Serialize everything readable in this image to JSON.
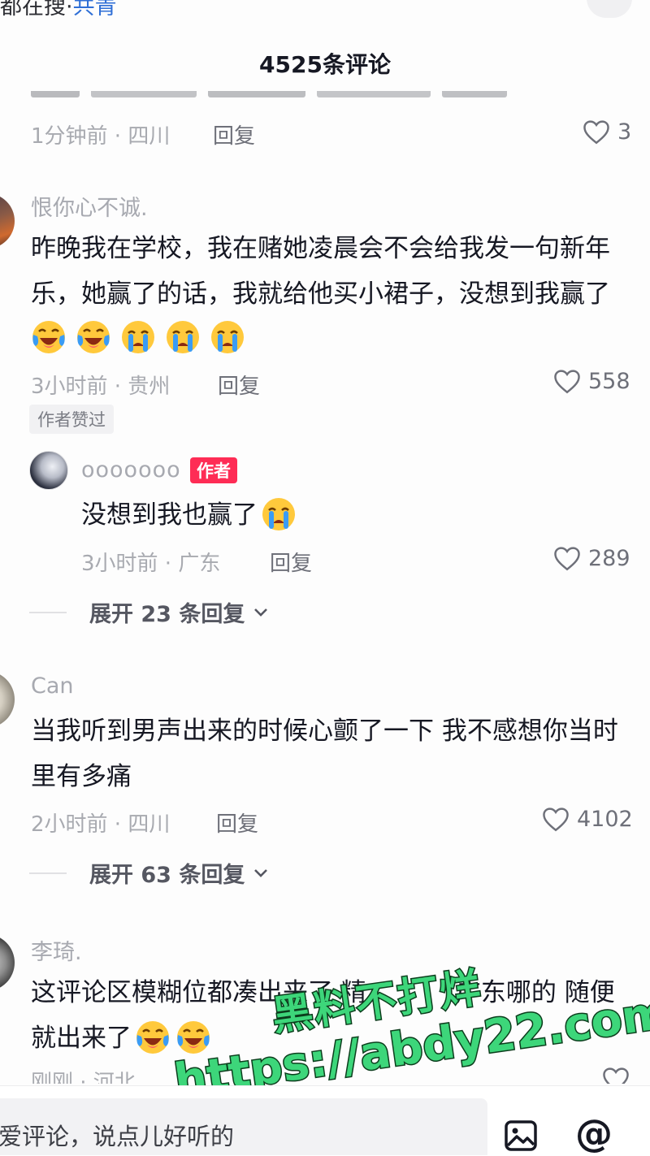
{
  "top": {
    "cut_text_left": "都在搜·",
    "cut_link": "共青",
    "title": "4525条评论"
  },
  "partial_comment": {
    "meta": "1分钟前 · 四川",
    "reply": "回复",
    "likes": "3"
  },
  "comments": [
    {
      "username": "恨你心不诚.",
      "line1": "昨晚我在学校，我在赌她凌晨会不会给我发一句新年",
      "line2": "乐，她赢了的话，我就给他买小裙子，没想到我赢了",
      "emojis": [
        "laugh-cry",
        "laugh-cry",
        "crying",
        "crying",
        "crying"
      ],
      "meta": "3小时前 · 贵州",
      "reply": "回复",
      "likes": "558",
      "badge": "作者赞过",
      "sub": {
        "username": "ooooooo",
        "tag": "作者",
        "text": "没想到我也赢了",
        "meta": "3小时前 · 广东",
        "reply": "回复",
        "likes": "289"
      },
      "expand": "展开 23 条回复"
    },
    {
      "username": "Can",
      "line1": "当我听到男声出来的时候心颤了一下 我不感想你当时",
      "line2": "里有多痛",
      "meta": "2小时前 · 四川",
      "reply": "回复",
      "likes": "4102",
      "expand": "展开 63 条回复"
    },
    {
      "username": "李琦.",
      "line1": "这评论区模糊位都凑出来了 精",
      "line1b": "广东哪的 随便",
      "line2": "就出来了",
      "meta": "刚刚 · 河北"
    }
  ],
  "watermark": {
    "line1": "黑料不打烊",
    "line2": "https://abdy22.com"
  },
  "input": {
    "placeholder": "爱评论，说点儿好听的"
  },
  "colors": {
    "author_tag": "#fe2c55",
    "watermark_fill": "#3dd67a",
    "watermark_stroke": "#0b3d1c"
  }
}
